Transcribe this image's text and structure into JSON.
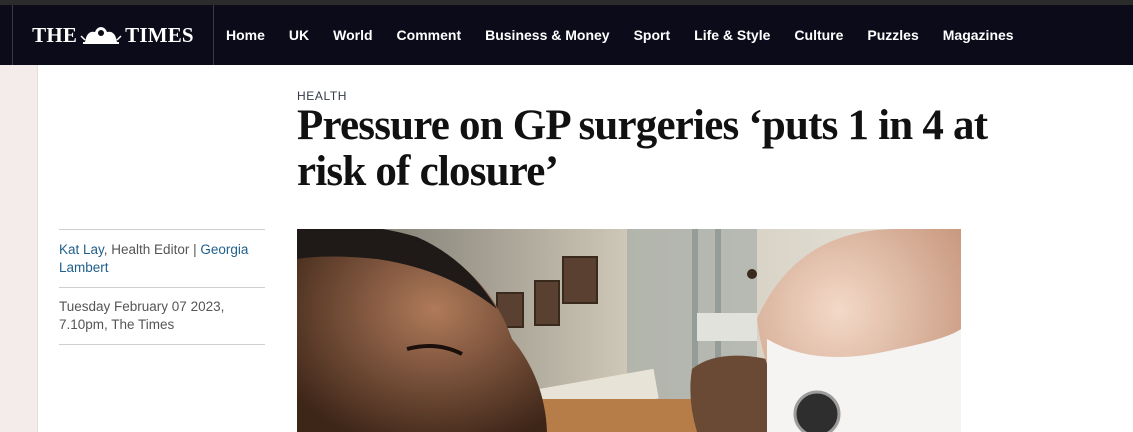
{
  "header": {
    "logo_text_left": "THE",
    "logo_text_right": "TIMES",
    "nav_items": [
      "Home",
      "UK",
      "World",
      "Comment",
      "Business & Money",
      "Sport",
      "Life & Style",
      "Culture",
      "Puzzles",
      "Magazines"
    ]
  },
  "article": {
    "section": "HEALTH",
    "headline": "Pressure on GP surgeries ‘puts 1 in 4 at risk of closure’",
    "byline": {
      "author1": "Kat Lay",
      "author1_role": ", Health Editor | ",
      "author2": "Georgia Lambert"
    },
    "dateline": "Tuesday February 07 2023, 7.10pm, The Times"
  },
  "colors": {
    "nav_background": "#0b0b1a",
    "link_blue": "#1f5f8b",
    "gutter": "#f3ecea"
  }
}
